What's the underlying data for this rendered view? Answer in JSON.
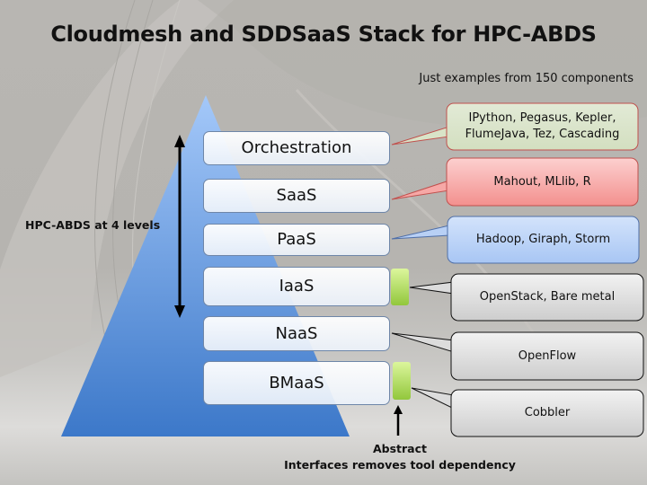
{
  "title": "Cloudmesh and SDDSaaS Stack for HPC-ABDS",
  "subtitle": "Just examples from 150 components",
  "levels_label": "HPC-ABDS at 4 levels",
  "layers": [
    {
      "label": "Orchestration"
    },
    {
      "label": "SaaS"
    },
    {
      "label": "PaaS"
    },
    {
      "label": "IaaS"
    },
    {
      "label": "NaaS"
    },
    {
      "label": "BMaaS"
    }
  ],
  "callouts": [
    {
      "text": "IPython, Pegasus, Kepler, FlumeJava, Tez, Cascading",
      "layer": "Orchestration",
      "fill": "#d9e4c8",
      "border": "#c0504d"
    },
    {
      "text": "Mahout, MLlib, R",
      "layer": "SaaS",
      "fill": "#f6a8a6",
      "border": "#c0504d"
    },
    {
      "text": "Hadoop, Giraph, Storm",
      "layer": "PaaS",
      "fill": "#b8d0f5",
      "border": "#4f6fa8"
    },
    {
      "text": "OpenStack, Bare metal",
      "layer": "IaaS",
      "fill": "#dcdcdc",
      "border": "#111111"
    },
    {
      "text": "OpenFlow",
      "layer": "NaaS",
      "fill": "#dcdcdc",
      "border": "#111111"
    },
    {
      "text": "Cobbler",
      "layer": "BMaaS",
      "fill": "#dcdcdc",
      "border": "#111111"
    }
  ],
  "interface_markers": [
    "IaaS",
    "BMaaS"
  ],
  "abstract_note": {
    "line1": "Abstract",
    "line2": "Interfaces removes tool dependency"
  },
  "colors": {
    "pyramid_top": "#9ec3f7",
    "pyramid_bottom": "#3f7acb",
    "interface_green_top": "#dcf59a",
    "interface_green_bottom": "#93c83e"
  }
}
